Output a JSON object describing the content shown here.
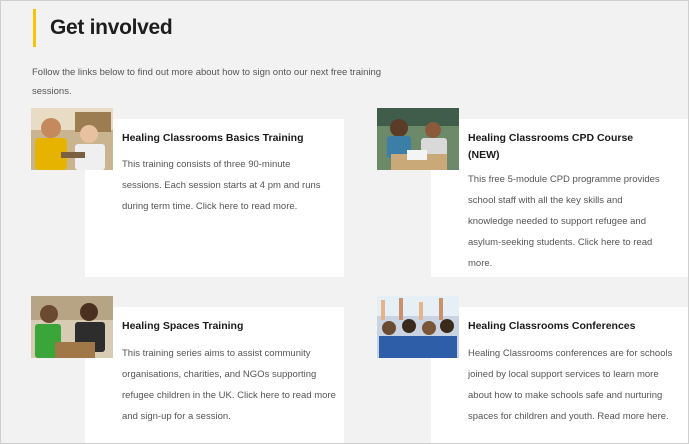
{
  "page": {
    "title": "Get involved",
    "intro": "Follow the links below to find out more about how to sign onto our next free training sessions.",
    "accent_color": "#f7c600"
  },
  "cards": [
    {
      "title": "Healing Classrooms Basics Training",
      "body": "This training consists of three 90-minute sessions. Each session starts at 4 pm and runs during term time. Click here to read more.",
      "image": "teacher-and-student-photo"
    },
    {
      "title": "Healing Classrooms CPD Course (NEW)",
      "body": "This free 5-module CPD programme provides school staff with all the key skills and knowledge needed to support refugee and asylum-seeking students. Click here to read more.",
      "image": "children-reading-photo"
    },
    {
      "title": "Healing Spaces Training",
      "body": "This training series aims to assist community organisations, charities, and NGOs supporting refugee children in the UK. Click here to read more and sign-up for a session.",
      "image": "children-playing-photo"
    },
    {
      "title": "Healing Classrooms Conferences",
      "body": "Healing Classrooms conferences are for schools joined by local support services to learn more about how to make schools safe and nurturing spaces for children and youth. Read more here.",
      "image": "classroom-hands-raised-photo"
    }
  ]
}
